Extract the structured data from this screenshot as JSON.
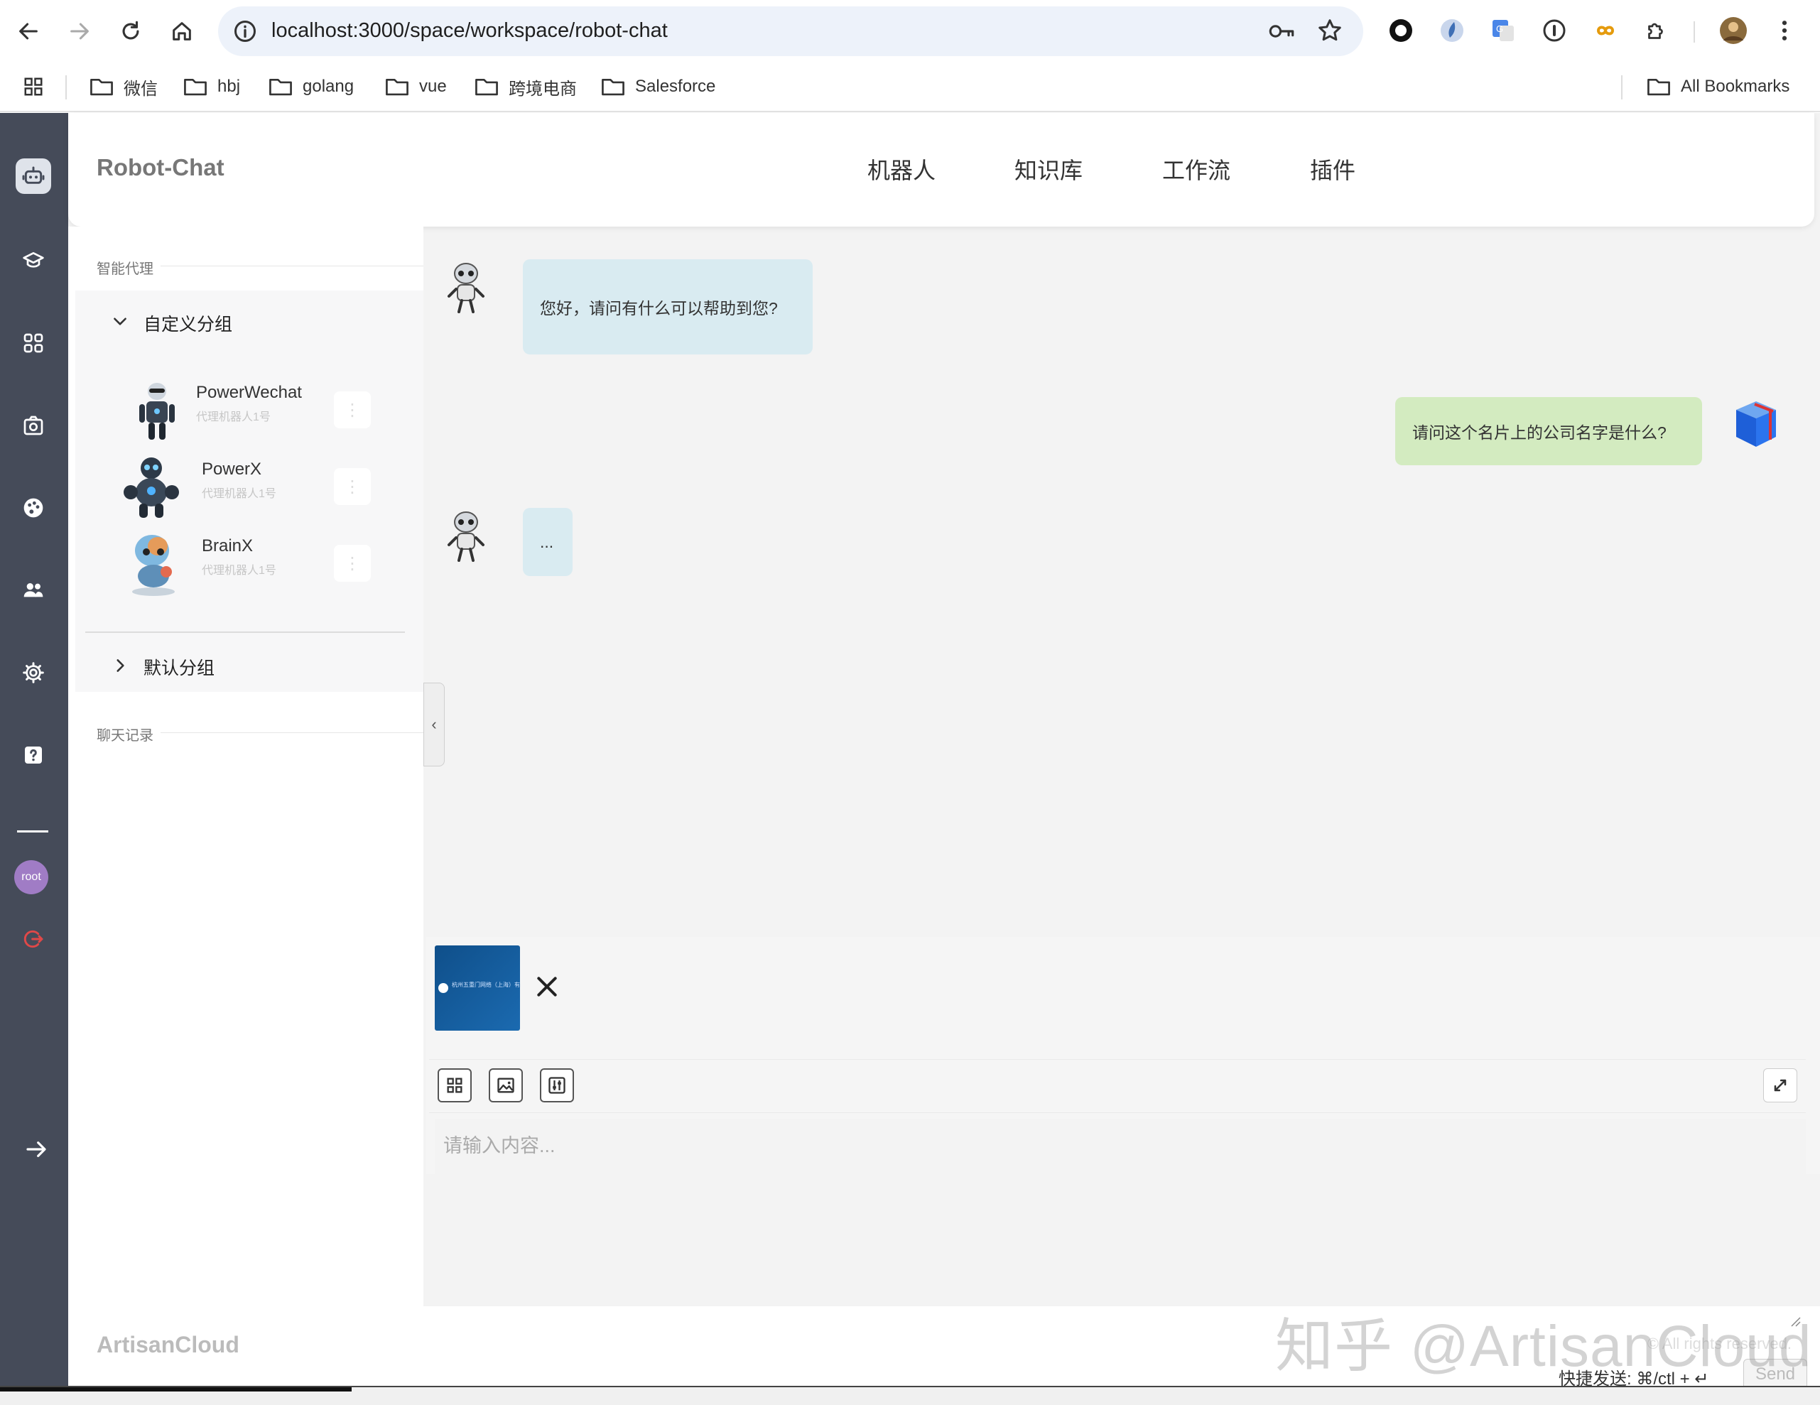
{
  "browser": {
    "url": "localhost:3000/space/workspace/robot-chat",
    "bookmarks": [
      {
        "label": "微信"
      },
      {
        "label": "hbj"
      },
      {
        "label": "golang"
      },
      {
        "label": "vue"
      },
      {
        "label": "跨境电商"
      },
      {
        "label": "Salesforce"
      }
    ],
    "all_bookmarks": "All Bookmarks"
  },
  "header": {
    "brand": "Robot-Chat",
    "nav": [
      {
        "label": "机器人"
      },
      {
        "label": "知识库"
      },
      {
        "label": "工作流"
      },
      {
        "label": "插件"
      }
    ]
  },
  "rail": {
    "icons": [
      "robot-icon",
      "graduation-cap-icon",
      "apps-grid-icon",
      "camera-icon",
      "palette-icon",
      "users-icon",
      "gear-icon",
      "help-icon"
    ],
    "user_avatar": "root"
  },
  "sidebar": {
    "agents_section": "智能代理",
    "groups": [
      {
        "label": "自定义分组",
        "expanded": true,
        "agents": [
          {
            "name": "PowerWechat",
            "subtitle": "代理机器人1号"
          },
          {
            "name": "PowerX",
            "subtitle": "代理机器人1号"
          },
          {
            "name": "BrainX",
            "subtitle": "代理机器人1号"
          }
        ]
      },
      {
        "label": "默认分组",
        "expanded": false
      }
    ],
    "history_section": "聊天记录"
  },
  "chat": {
    "messages": [
      {
        "role": "bot",
        "text": "您好，请问有什么可以帮助到您?"
      },
      {
        "role": "user",
        "text": "请问这个名片上的公司名字是什么?"
      },
      {
        "role": "bot",
        "text": "..."
      }
    ],
    "attachment": {
      "thumb_text": "杭州五重门网络（上海）有限公司"
    },
    "input_placeholder": "请输入内容...",
    "shortcut_hint": "快捷发送: ⌘/ctl + ↵",
    "send_label": "Send"
  },
  "footer": {
    "brand": "ArtisanCloud",
    "copyright": "© All rights reserved."
  },
  "watermark": "知乎 @ArtisanCloud",
  "colors": {
    "rail": "#454b59",
    "bot_bubble": "#d9ebf1",
    "user_bubble": "#d3ebc0",
    "logout": "#e04848",
    "avatar": "#a07cc5"
  }
}
